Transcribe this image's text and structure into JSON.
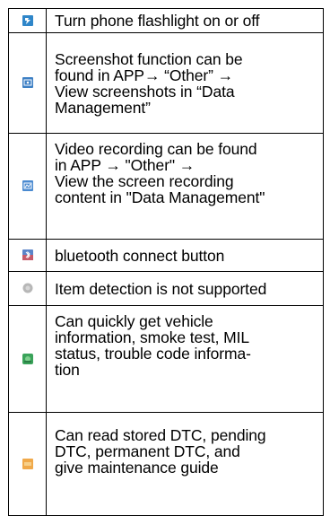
{
  "rows": [
    {
      "icon": "flashlight-icon",
      "text": "Turn phone flashlight on or off"
    },
    {
      "icon": "screenshot-icon",
      "text": "Screenshot function can be\nfound in APP→ “Other” →\nView screenshots in “Data\nManagement”"
    },
    {
      "icon": "screen-recording-icon",
      "text": "Video recording can be found\nin APP → \"Other\" →\nView the screen recording\ncontent in \"Data Management\""
    },
    {
      "icon": "bluetooth-icon",
      "text": "bluetooth connect button"
    },
    {
      "icon": "item-detection-icon",
      "text": "Item detection is not supported"
    },
    {
      "icon": "vehicle-info-icon",
      "text": "Can quickly get vehicle\ninformation, smoke test, MIL\nstatus, trouble code informa-\ntion"
    },
    {
      "icon": "read-dtc-icon",
      "text": "Can read stored DTC, pending\nDTC, permanent DTC, and\ngive maintenance guide"
    }
  ],
  "colors": {
    "flashlight": "#2f86c9",
    "screenshot": "#3c7fc4",
    "recording": "#4a8ad0",
    "bluetooth": "#c55a6a",
    "detection": "#b7b7b7",
    "vehicle": "#3aa35a",
    "dtc": "#f0a94a"
  }
}
